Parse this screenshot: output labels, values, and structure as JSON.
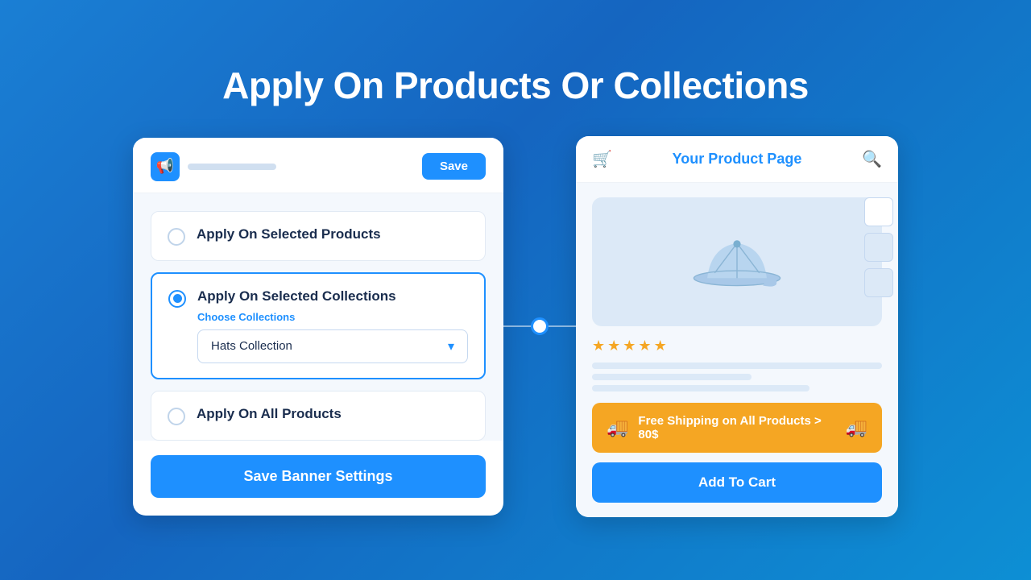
{
  "page": {
    "title": "Apply On Products Or Collections",
    "background_color": "#1565c0"
  },
  "left_card": {
    "header": {
      "save_button_label": "Save"
    },
    "options": [
      {
        "id": "selected-products",
        "label": "Apply On Selected Products",
        "selected": false
      },
      {
        "id": "selected-collections",
        "label": "Apply On Selected Collections",
        "selected": true,
        "sub_label": "Choose Collections",
        "dropdown_value": "Hats Collection",
        "dropdown_placeholder": "Hats Collection"
      },
      {
        "id": "all-products",
        "label": "Apply On All Products",
        "selected": false
      }
    ],
    "save_banner_label": "Save Banner Settings"
  },
  "right_card": {
    "header_title": "Your Product Page",
    "stars_count": 5,
    "shipping_banner_text": "Free Shipping on All Products > 80$",
    "add_to_cart_label": "Add To Cart"
  },
  "icons": {
    "cart": "🛒",
    "search": "🔍",
    "truck": "🚚",
    "megaphone": "📢",
    "chevron_down": "▾"
  }
}
